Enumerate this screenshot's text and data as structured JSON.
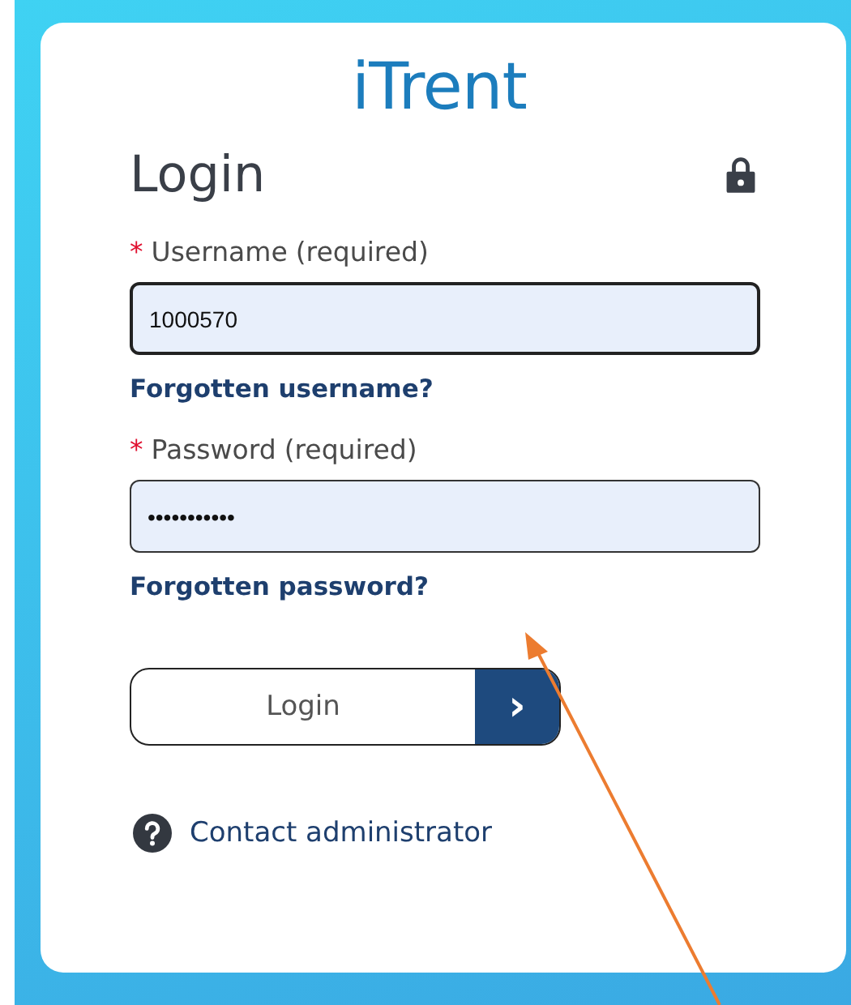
{
  "logo": "iTrent",
  "title": "Login",
  "fields": [
    {
      "required_mark": "*",
      "label": "Username",
      "hint": "(required)",
      "value": "1000570",
      "focused": true,
      "link": "Forgotten username?"
    },
    {
      "required_mark": "*",
      "label": "Password",
      "hint": "(required)",
      "value": "•••••••••••",
      "focused": false,
      "link": "Forgotten password?"
    }
  ],
  "login_button": {
    "label": "Login",
    "arrow": "›"
  },
  "contact_link": "Contact administrator"
}
